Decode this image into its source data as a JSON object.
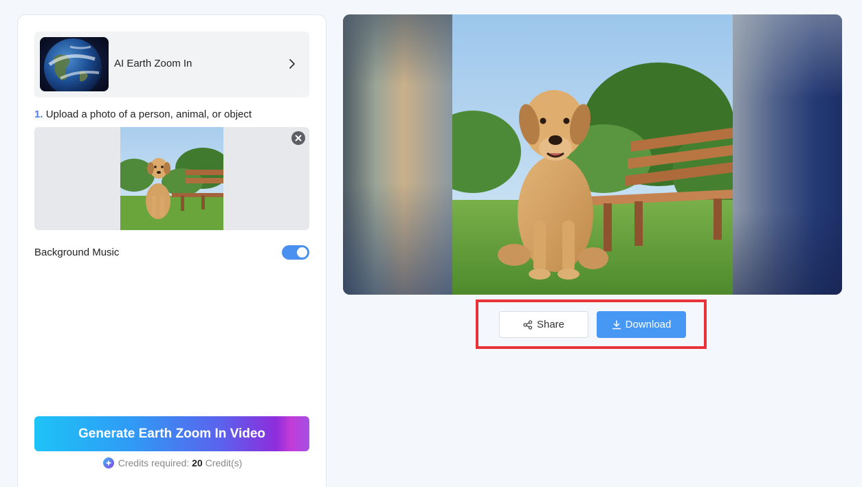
{
  "tool": {
    "title": "AI Earth Zoom In",
    "thumbnail_icon": "earth-globe-icon",
    "chevron_icon": "chevron-right-icon"
  },
  "upload": {
    "step_number": "1.",
    "step_text": "Upload a photo of a person, animal, or object",
    "remove_icon": "close-icon"
  },
  "settings": {
    "background_music_label": "Background Music",
    "background_music_enabled": true
  },
  "generate": {
    "button_label": "Generate Earth Zoom In Video",
    "credits_prefix": "Credits required:",
    "credits_amount": "20",
    "credits_suffix": "Credit(s)",
    "credit_icon": "sparkle-icon"
  },
  "actions": {
    "share_label": "Share",
    "share_icon": "share-icon",
    "download_label": "Download",
    "download_icon": "download-icon"
  },
  "colors": {
    "accent": "#4797f5",
    "toggle_on": "#4a90f0",
    "highlight": "#e8333a",
    "step_number": "#4c7cf0"
  }
}
